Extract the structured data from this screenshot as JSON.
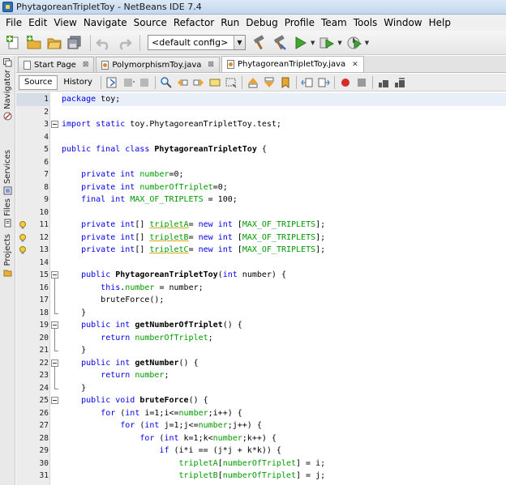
{
  "window": {
    "title": "PhytagoreanTripletToy - NetBeans IDE 7.4"
  },
  "menu": [
    "File",
    "Edit",
    "View",
    "Navigate",
    "Source",
    "Refactor",
    "Run",
    "Debug",
    "Profile",
    "Team",
    "Tools",
    "Window",
    "Help"
  ],
  "toolbar": {
    "config_value": "<default config>"
  },
  "side_tabs": [
    "Navigator",
    "Services",
    "Files",
    "Projects"
  ],
  "editor_tabs": [
    {
      "label": "Start Page",
      "active": false
    },
    {
      "label": "PolymorphismToy.java",
      "active": false
    },
    {
      "label": "PhytagoreanTripletToy.java",
      "active": true
    }
  ],
  "editor_modes": {
    "source": "Source",
    "history": "History"
  },
  "code_lines": [
    {
      "num": "1",
      "current": true,
      "html": "<span class=\"kw\">package</span> toy;"
    },
    {
      "num": "2",
      "html": ""
    },
    {
      "num": "3",
      "fold": "start",
      "html": "<span class=\"kw\">import static</span> toy.PhytagoreanTripletToy.test;"
    },
    {
      "num": "4",
      "html": ""
    },
    {
      "num": "5",
      "html": "<span class=\"kw\">public final class</span> <span class=\"cls\">PhytagoreanTripletToy</span> {"
    },
    {
      "num": "6",
      "html": ""
    },
    {
      "num": "7",
      "html": "    <span class=\"kw\">private int</span> <span class=\"fld\">number</span>=0;"
    },
    {
      "num": "8",
      "html": "    <span class=\"kw\">private int</span> <span class=\"fld\">numberOfTriplet</span>=0;"
    },
    {
      "num": "9",
      "html": "    <span class=\"kw\">final int</span> <span class=\"fld\">MAX_OF_TRIPLETS</span> = 100;"
    },
    {
      "num": "10",
      "html": ""
    },
    {
      "num": "11",
      "warn": true,
      "html": "    <span class=\"kw\">private int</span>[] <span class=\"fld uline\">tripletA</span>= <span class=\"kw\">new int</span> [<span class=\"fld\">MAX_OF_TRIPLETS</span>];"
    },
    {
      "num": "12",
      "warn": true,
      "html": "    <span class=\"kw\">private int</span>[] <span class=\"fld uline\">tripletB</span>= <span class=\"kw\">new int</span> [<span class=\"fld\">MAX_OF_TRIPLETS</span>];"
    },
    {
      "num": "13",
      "warn": true,
      "html": "    <span class=\"kw\">private int</span>[] <span class=\"fld uline\">tripletC</span>= <span class=\"kw\">new int</span> [<span class=\"fld\">MAX_OF_TRIPLETS</span>];"
    },
    {
      "num": "14",
      "html": ""
    },
    {
      "num": "15",
      "fold": "start",
      "html": "    <span class=\"kw\">public</span> <span class=\"cls\">PhytagoreanTripletToy</span>(<span class=\"kw\">int</span> number) {"
    },
    {
      "num": "16",
      "html": "        <span class=\"kw\">this</span>.<span class=\"fld\">number</span> = number;"
    },
    {
      "num": "17",
      "html": "        bruteForce();"
    },
    {
      "num": "18",
      "fold": "end",
      "html": "    }"
    },
    {
      "num": "19",
      "fold": "start",
      "html": "    <span class=\"kw\">public int</span> <span class=\"cls\">getNumberOfTriplet</span>() {"
    },
    {
      "num": "20",
      "html": "        <span class=\"kw\">return</span> <span class=\"fld\">numberOfTriplet</span>;"
    },
    {
      "num": "21",
      "fold": "end",
      "html": "    }"
    },
    {
      "num": "22",
      "fold": "start",
      "html": "    <span class=\"kw\">public int</span> <span class=\"cls\">getNumber</span>() {"
    },
    {
      "num": "23",
      "html": "        <span class=\"kw\">return</span> <span class=\"fld\">number</span>;"
    },
    {
      "num": "24",
      "fold": "end",
      "html": "    }"
    },
    {
      "num": "25",
      "fold": "start",
      "html": "    <span class=\"kw\">public void</span> <span class=\"cls\">bruteForce</span>() {"
    },
    {
      "num": "26",
      "html": "        <span class=\"kw\">for</span> (<span class=\"kw\">int</span> i=1;i&lt;=<span class=\"fld\">number</span>;i++) {"
    },
    {
      "num": "27",
      "html": "            <span class=\"kw\">for</span> (<span class=\"kw\">int</span> j=1;j&lt;=<span class=\"fld\">number</span>;j++) {"
    },
    {
      "num": "28",
      "html": "                <span class=\"kw\">for</span> (<span class=\"kw\">int</span> k=1;k&lt;<span class=\"fld\">number</span>;k++) {"
    },
    {
      "num": "29",
      "html": "                    <span class=\"kw\">if</span> (i*i == (j*j + k*k)) {"
    },
    {
      "num": "30",
      "html": "                        <span class=\"fld\">tripletA</span>[<span class=\"fld\">numberOfTriplet</span>] = i;"
    },
    {
      "num": "31",
      "html": "                        <span class=\"fld\">tripletB</span>[<span class=\"fld\">numberOfTriplet</span>] = j;"
    }
  ]
}
